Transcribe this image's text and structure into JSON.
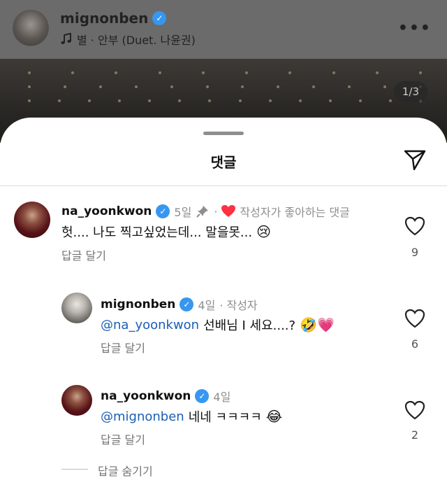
{
  "post": {
    "username": "mignonben",
    "song": "별 · 안부 (Duet. 나윤권)",
    "music_icon": "music-note-icon",
    "more_icon": "more-horizontal-icon",
    "page_indicator": "1/3"
  },
  "sheet": {
    "title": "댓글",
    "share_icon": "send-icon"
  },
  "comments": [
    {
      "username": "na_yoonkwon",
      "time": "5일",
      "pinned_icon": "pin-icon",
      "author_liked": "작성자가 좋아하는 댓글",
      "text": "헛.... 나도 찍고싶었는데... 말을못...",
      "emoji": "😢",
      "reply_label": "답글 달기",
      "likes": "9"
    },
    {
      "username": "mignonben",
      "time": "4일",
      "author_tag": "· 작성자",
      "mention": "@na_yoonkwon",
      "text": "선배님 I 세요....?",
      "emoji": "🤣💗",
      "reply_label": "답글 달기",
      "likes": "6"
    },
    {
      "username": "na_yoonkwon",
      "time": "4일",
      "mention": "@mignonben",
      "text": "네네 ㅋㅋㅋㅋ",
      "emoji": "😂",
      "reply_label": "답글 달기",
      "likes": "2"
    }
  ],
  "hide_replies": "답글 숨기기",
  "colors": {
    "verified": "#3797f0",
    "mention": "#1a5fb4",
    "heart": "#ff3040"
  }
}
